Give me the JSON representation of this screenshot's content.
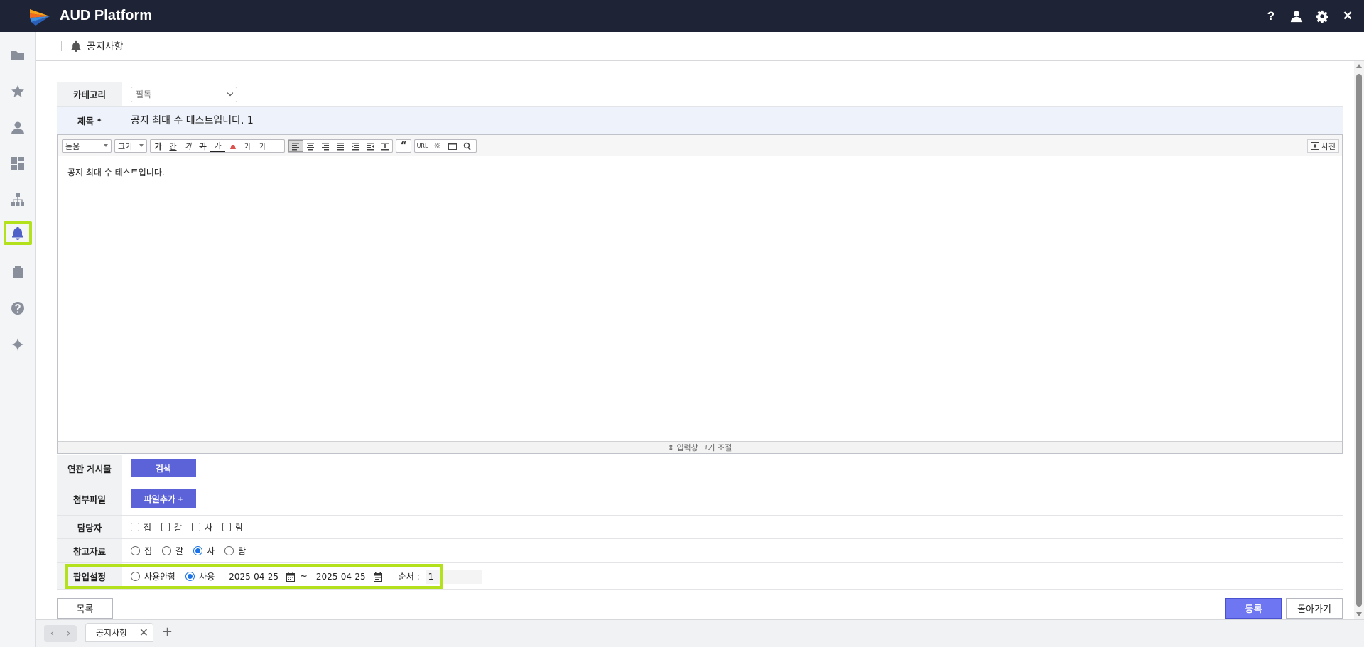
{
  "app": {
    "title": "AUD Platform"
  },
  "topbar": {
    "icons": [
      "help-icon",
      "user-icon",
      "settings-icon",
      "close-icon"
    ],
    "help_label": "?",
    "close_label": "✕"
  },
  "sidebar": {
    "items": [
      "folder-icon",
      "star-icon",
      "person-icon",
      "dashboard-icon",
      "org-chart-icon",
      "bell-icon",
      "clipboard-icon",
      "question-icon",
      "sparkle-icon"
    ],
    "active": "bell-icon"
  },
  "header": {
    "title": "공지사항"
  },
  "form": {
    "category": {
      "label": "카테고리",
      "value": "필독"
    },
    "subject": {
      "label": "제목 *",
      "value": "공지 최대 수 테스트입니다. 1"
    }
  },
  "editor": {
    "font": "돋움",
    "size": "크기",
    "bold": "가",
    "underline": "간",
    "italic": "가",
    "strike": "가",
    "fontcolor": "가",
    "superscript": "가",
    "subscript": "가",
    "url": "URL",
    "photo_label": "사진",
    "body": "공지 최대 수 테스트입니다.",
    "resize_label": "입력창 크기 조절"
  },
  "related": {
    "label": "연관 게시물",
    "button": "검색"
  },
  "attach": {
    "label": "첨부파일",
    "button": "파일추가 +"
  },
  "assignee": {
    "label": "담당자",
    "options": [
      "집",
      "갈",
      "사",
      "람"
    ]
  },
  "reference": {
    "label": "참고자료",
    "options": [
      "집",
      "갈",
      "사",
      "람"
    ],
    "selected": "사"
  },
  "popup": {
    "label": "팝업설정",
    "opt_off": "사용안함",
    "opt_on": "사용",
    "selected": "사용",
    "start_date": "2025-04-25",
    "tilde": "~",
    "end_date": "2025-04-25",
    "order_label": "순서 :",
    "order_value": "1"
  },
  "footer": {
    "list_button": "목록",
    "submit_button": "등록",
    "back_button": "돌아가기"
  },
  "tabs": [
    {
      "label": "공지사항"
    }
  ],
  "tabbar": {
    "prev": "‹",
    "next": "›",
    "close_symbol": "✕",
    "add_symbol": "+"
  }
}
